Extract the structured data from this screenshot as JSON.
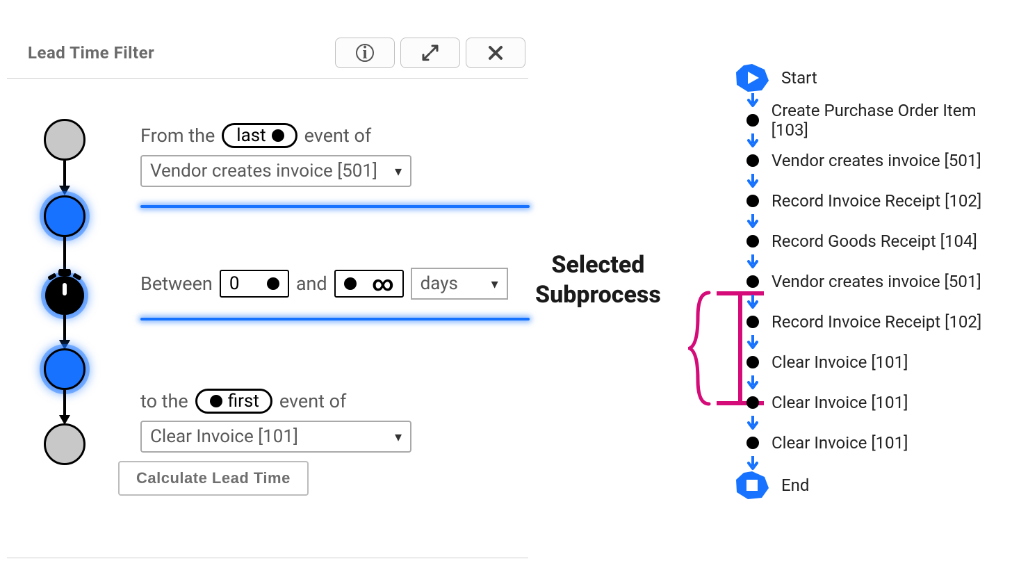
{
  "panel": {
    "title": "Lead Time Filter",
    "tools": {
      "info": "ⓘ",
      "expand": "⤢",
      "close": "✕"
    },
    "from": {
      "prefix": "From the",
      "toggle": "last",
      "suffix": "event of",
      "event": "Vendor creates invoice [501]"
    },
    "between": {
      "prefix": "Between",
      "min": "0",
      "and": "and",
      "max": "∞",
      "unit": "days"
    },
    "to": {
      "prefix": "to the",
      "toggle": "first",
      "suffix": "event of",
      "event": "Clear Invoice [101]"
    },
    "calc_label": "Calculate Lead Time"
  },
  "annotation": {
    "line1": "Selected",
    "line2": "Subprocess"
  },
  "flow": {
    "start": "Start",
    "end": "End",
    "steps": [
      "Create Purchase Order Item [103]",
      "Vendor creates invoice [501]",
      "Record Invoice Receipt [102]",
      "Record Goods Receipt [104]",
      "Vendor creates invoice [501]",
      "Record Invoice Receipt [102]",
      "Clear Invoice [101]",
      "Clear Invoice [101]",
      "Clear Invoice [101]"
    ],
    "selected_range": [
      4,
      6
    ]
  },
  "colors": {
    "blue": "#1773ff",
    "pink": "#d40b78"
  }
}
